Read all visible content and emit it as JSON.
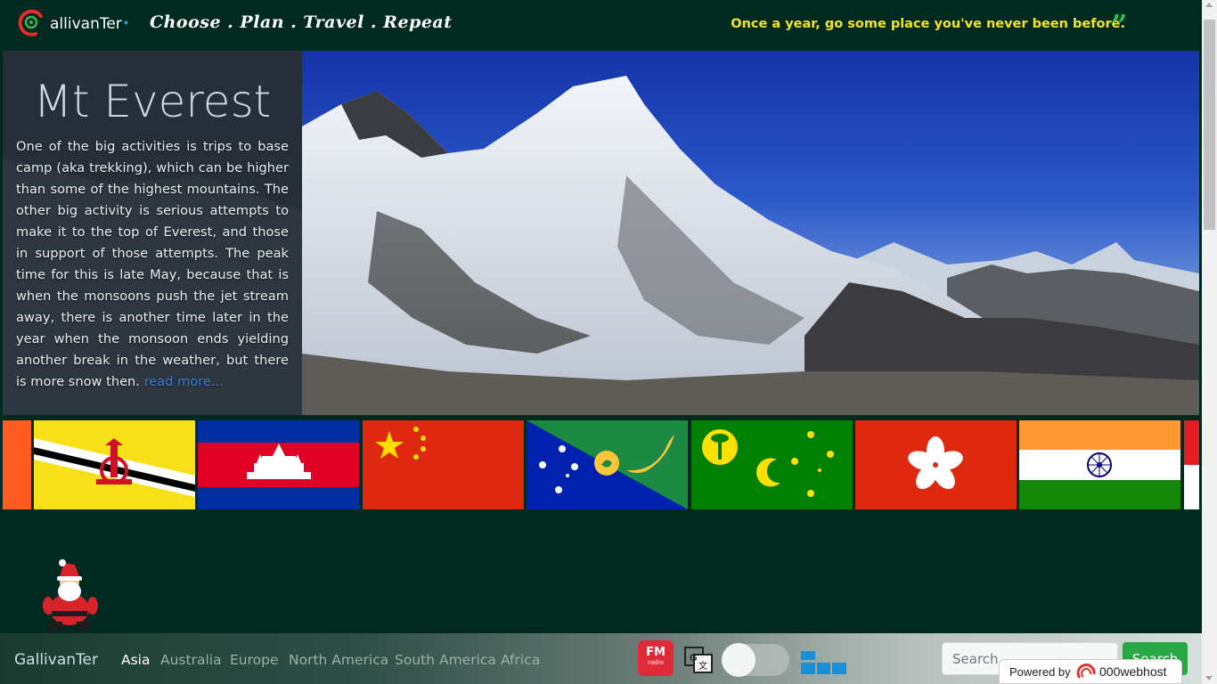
{
  "header": {
    "logo_text": "allivanTer",
    "tagline": "Choose . Plan . Travel . Repeat",
    "quote": "Once a year, go some place you've never been before.",
    "quote_mark": "”"
  },
  "hero": {
    "title": "Mt Everest",
    "body": "One of the big activities is trips to base camp (aka trekking), which can be higher than some of the highest mountains. The other big activity is serious attempts to make it to the top of Everest, and those in support of those attempts. The peak time for this is late May, because that is when the monsoons push the jet stream away, there is another time later in the year when the monsoon ends yielding another break in the weather, but there is more snow then. ",
    "read_more": "read more..."
  },
  "flags": [
    "Bhutan",
    "Brunei",
    "Cambodia",
    "China",
    "Christmas Island",
    "Cocos (Keeling) Islands",
    "Hong Kong",
    "India",
    "Indonesia"
  ],
  "navbar": {
    "brand": "GallivanTer",
    "links": [
      "Asia",
      "Australia",
      "Europe",
      "North America",
      "South America",
      "Africa"
    ],
    "active_link": "Asia",
    "fm_label": "FM",
    "fm_sublabel": "radio",
    "search_placeholder": "Search",
    "search_button": "Search"
  },
  "footer_badge": {
    "powered_by": "Powered by",
    "host": "000webhost"
  },
  "colors": {
    "background": "#002a1f",
    "quote": "#f5e51f",
    "quote_mark": "#2fbf48",
    "search_button": "#28a745",
    "fm_badge": "#e02a3a"
  }
}
